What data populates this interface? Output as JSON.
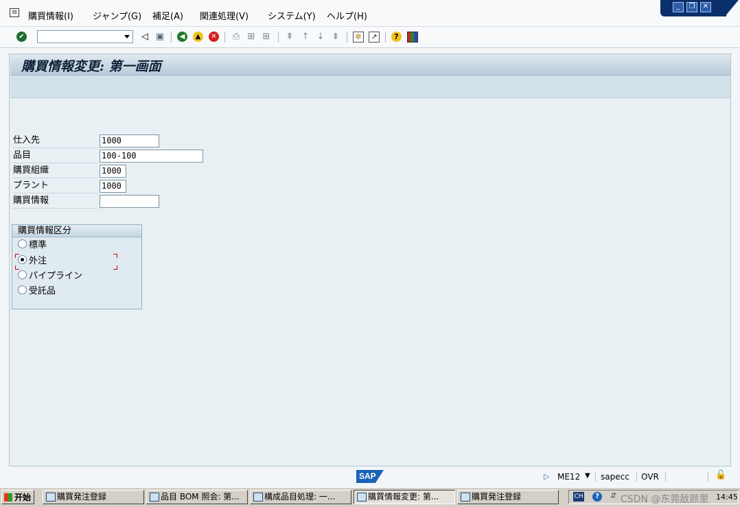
{
  "menubar": {
    "items": [
      "購買情報(I)",
      "ジャンプ(G)",
      "補足(A)",
      "関連処理(V)",
      "システム(Y)",
      "ヘルプ(H)"
    ]
  },
  "toolbar": {
    "command_field_value": "",
    "icons": [
      "enter-icon",
      "back-arrow-icon",
      "save-icon",
      "back-icon",
      "exit-icon",
      "cancel-icon",
      "print-icon",
      "find-icon",
      "find-next-icon",
      "first-page-icon",
      "previous-page-icon",
      "next-page-icon",
      "last-page-icon",
      "create-session-icon",
      "shortcut-icon",
      "help-icon",
      "layout-icon"
    ]
  },
  "screen": {
    "title": "購買情報変更: 第一画面"
  },
  "form": {
    "fields": [
      {
        "label": "仕入先",
        "value": "1000"
      },
      {
        "label": "品目",
        "value": "100-100"
      },
      {
        "label": "購買組織",
        "value": "1000"
      },
      {
        "label": "プラント",
        "value": "1000"
      },
      {
        "label": "購買情報",
        "value": ""
      }
    ]
  },
  "info_category": {
    "title": "購買情報区分",
    "options": [
      {
        "label": "標準",
        "selected": false
      },
      {
        "label": "外注",
        "selected": true
      },
      {
        "label": "パイプライン",
        "selected": false
      },
      {
        "label": "受託品",
        "selected": false
      }
    ]
  },
  "statusbar": {
    "transaction": "ME12",
    "server": "sapecc",
    "mode": "OVR",
    "logo": "SAP"
  },
  "taskbar": {
    "start": "开始",
    "tasks": [
      "購買発注登録",
      "品目 BOM 照会: 第...",
      "構成品目処理: 一...",
      "購買情報変更: 第...",
      "購買発注登録"
    ],
    "tray": {
      "ime": "CH",
      "watermark": "CSDN @东莞敌颜里",
      "clock": "14:45"
    }
  },
  "colors": {
    "title_bar": "#b9ccda",
    "content_bg": "#e9f0f4",
    "sap_blue": "#1b62b8",
    "focus_red": "#d00000"
  }
}
